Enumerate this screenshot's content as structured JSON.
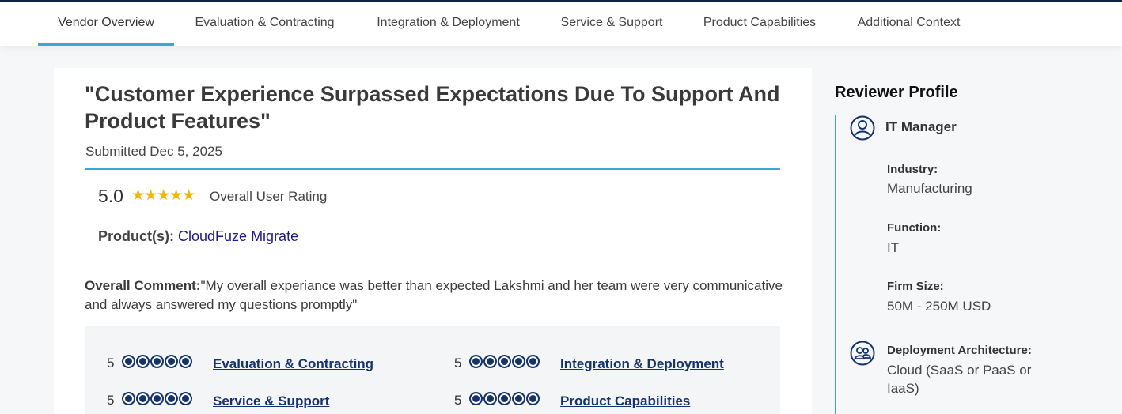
{
  "tabs": [
    {
      "label": "Vendor Overview",
      "active": true
    },
    {
      "label": "Evaluation & Contracting"
    },
    {
      "label": "Integration & Deployment"
    },
    {
      "label": "Service & Support"
    },
    {
      "label": "Product Capabilities"
    },
    {
      "label": "Additional Context"
    }
  ],
  "review": {
    "title": "\"Customer Experience Surpassed Expectations Due To Support And Product Features\"",
    "submitted": "Submitted Dec 5, 2025",
    "score": "5.0",
    "stars": "★★★★★",
    "overall_label": "Overall User Rating",
    "products_label": "Product(s):",
    "product": "CloudFuze Migrate",
    "comment_label": "Overall Comment:",
    "comment": "\"My overall experiance was better than expected Lakshmi and her team were very communicative and always answered my questions promptly\""
  },
  "ratings": [
    {
      "score": "5",
      "label": "Evaluation & Contracting"
    },
    {
      "score": "5",
      "label": "Integration & Deployment"
    },
    {
      "score": "5",
      "label": "Service & Support"
    },
    {
      "score": "5",
      "label": "Product Capabilities"
    }
  ],
  "profile": {
    "heading": "Reviewer Profile",
    "role": "IT Manager",
    "industry_label": "Industry:",
    "industry": "Manufacturing",
    "function_label": "Function:",
    "function": "IT",
    "firm_size_label": "Firm Size:",
    "firm_size": "50M - 250M USD",
    "deployment_label": "Deployment Architecture:",
    "deployment": "Cloud (SaaS or PaaS or IaaS)"
  },
  "colors": {
    "accent": "#3aa7d8",
    "navy": "#14336b",
    "star": "#f2b705"
  }
}
